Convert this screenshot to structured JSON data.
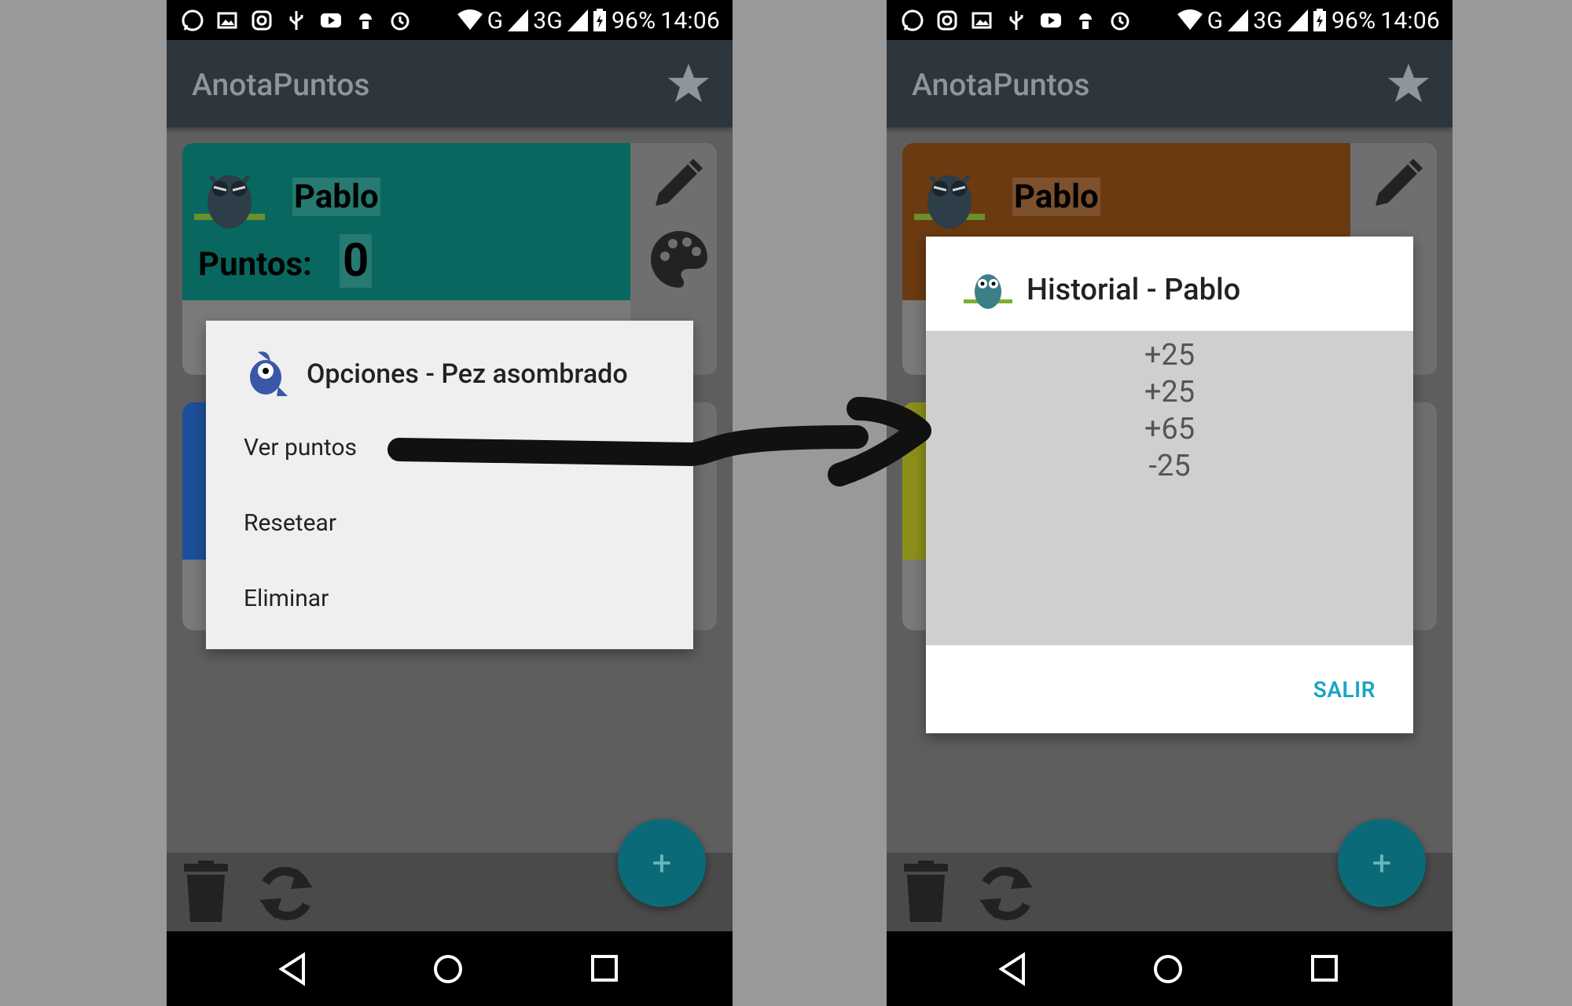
{
  "colors": {
    "card_left_top": "#08685f",
    "card_right_top": "#6b3a10",
    "card_left_second": "#1e4f9a",
    "card_right_second": "#8c8f1a",
    "accent": "#1aa5c2"
  },
  "status": {
    "network_g": "G",
    "network_3g": "3G",
    "battery": "96%",
    "time": "14:06"
  },
  "app": {
    "title": "AnotaPuntos"
  },
  "left": {
    "card": {
      "name": "Pablo",
      "points_label": "Puntos:",
      "points": "0"
    },
    "dialog": {
      "title": "Opciones - Pez asombrado",
      "items": [
        "Ver puntos",
        "Resetear",
        "Eliminar"
      ]
    }
  },
  "right": {
    "card": {
      "name": "Pablo"
    },
    "dialog": {
      "title": "Historial - Pablo",
      "history": [
        "+25",
        "+25",
        "+65",
        "-25"
      ],
      "button": "SALIR"
    }
  },
  "icons": [
    "whatsapp-icon",
    "gallery-icon",
    "instagram-icon",
    "usb-icon",
    "youtube-icon",
    "android-icon",
    "alarm-icon",
    "wifi-icon",
    "signal-icon",
    "battery-icon",
    "star-icon",
    "pencil-icon",
    "palette-icon",
    "owl-icon",
    "fish-icon",
    "trash-icon",
    "refresh-icon",
    "plus-icon",
    "back-icon",
    "home-icon",
    "recents-icon"
  ]
}
